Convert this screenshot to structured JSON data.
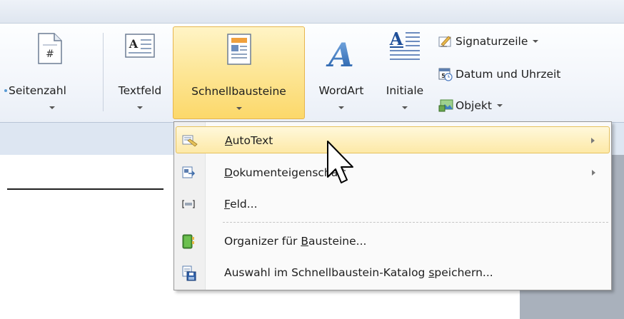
{
  "ribbon": {
    "seitenzahl": "Seitenzahl",
    "textfeld": "Textfeld",
    "schnellbausteine": "Schnellbausteine",
    "wordart": "WordArt",
    "initiale": "Initiale",
    "signaturzeile": "Signaturzeile",
    "datum": "Datum und Uhrzeit",
    "objekt": "Objekt"
  },
  "menu": {
    "items": [
      {
        "pre": "",
        "key": "A",
        "post": "utoText",
        "submenu": true
      },
      {
        "pre": "",
        "key": "D",
        "post": "okumenteigenschaft",
        "submenu": true
      },
      {
        "pre": "",
        "key": "F",
        "post": "eld...",
        "submenu": false
      },
      {
        "pre": "Organizer für ",
        "key": "B",
        "post": "austeine...",
        "submenu": false
      },
      {
        "pre": "Auswahl im Schnellbaustein-Katalog ",
        "key": "s",
        "post": "peichern...",
        "submenu": false
      }
    ]
  },
  "colors": {
    "highlight": "#fde9a7",
    "accent_border": "#e7b54d"
  }
}
